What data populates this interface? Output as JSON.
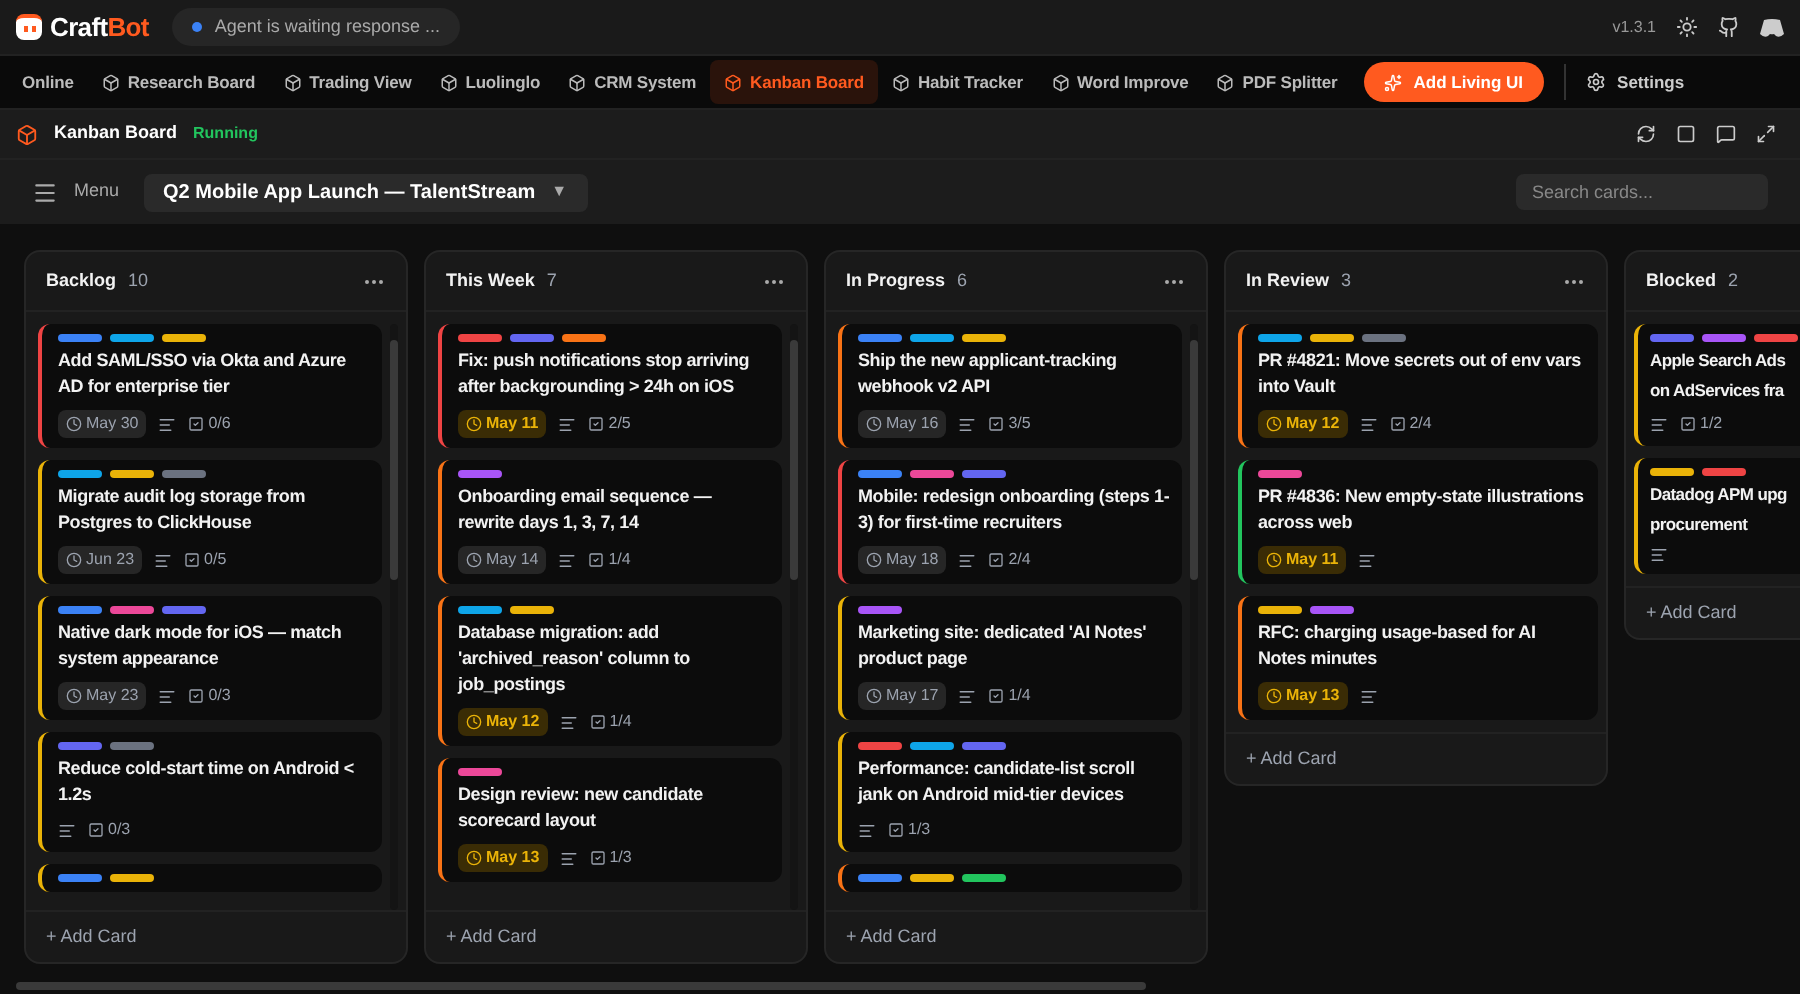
{
  "app": {
    "brand": [
      "Craft",
      "Bot"
    ],
    "status": {
      "text": "Agent is waiting response ...",
      "color": "#3b82f6"
    },
    "version": "v1.3.1"
  },
  "tabs": [
    {
      "label": "Online",
      "selected": false
    },
    {
      "label": "Research Board",
      "selected": false
    },
    {
      "label": "Trading View",
      "selected": false
    },
    {
      "label": "Luolinglo",
      "selected": false
    },
    {
      "label": "CRM System",
      "selected": false
    },
    {
      "label": "Kanban Board",
      "selected": true
    },
    {
      "label": "Habit Tracker",
      "selected": false
    },
    {
      "label": "Word Improve",
      "selected": false
    },
    {
      "label": "PDF Splitter",
      "selected": false
    }
  ],
  "add_button": "Add Living UI",
  "settings": "Settings",
  "panel": {
    "title": "Kanban Board",
    "status": "Running"
  },
  "toolbar": {
    "menu": "Menu",
    "board": "Q2 Mobile App Launch — TalentStream",
    "board_caret": "▼",
    "search": {
      "placeholder": "Search cards..."
    }
  },
  "columns": [
    {
      "name": "Backlog",
      "count": "10",
      "add_card": "+ Add Card",
      "cards": [
        {
          "color": "#ef4444",
          "labels": [
            {
              "color": "#3b82f6"
            },
            {
              "color": "#0ea5e9"
            },
            {
              "color": "#eab308"
            }
          ],
          "title": "Add SAML/SSO via Okta and Azure AD for enterprise tier",
          "due": {
            "text": "May 30",
            "soon": false
          },
          "notes": true,
          "checklist": "0/6"
        },
        {
          "color": "#eab308",
          "labels": [
            {
              "color": "#0ea5e9"
            },
            {
              "color": "#eab308"
            },
            {
              "color": "#6b7280"
            }
          ],
          "title": "Migrate audit log storage from Postgres to ClickHouse",
          "due": {
            "text": "Jun 23",
            "soon": false
          },
          "notes": true,
          "checklist": "0/5"
        },
        {
          "color": "#eab308",
          "labels": [
            {
              "color": "#3b82f6"
            },
            {
              "color": "#ec4899"
            },
            {
              "color": "#6366f1"
            }
          ],
          "title": "Native dark mode for iOS — match system appearance",
          "due": {
            "text": "May 23",
            "soon": false
          },
          "notes": true,
          "checklist": "0/3"
        },
        {
          "color": "#eab308",
          "labels": [
            {
              "color": "#6366f1"
            },
            {
              "color": "#6b7280"
            }
          ],
          "title": "Reduce cold-start time on Android < 1.2s",
          "notes": true,
          "checklist": "0/3"
        },
        {
          "color": "#eab308",
          "labels": [
            {
              "color": "#3b82f6"
            },
            {
              "color": "#eab308"
            }
          ]
        }
      ]
    },
    {
      "name": "This Week",
      "count": "7",
      "add_card": "+ Add Card",
      "cards": [
        {
          "color": "#ef4444",
          "labels": [
            {
              "color": "#ef4444"
            },
            {
              "color": "#6366f1"
            },
            {
              "color": "#f97316"
            }
          ],
          "title": "Fix: push notifications stop arriving after backgrounding > 24h on iOS",
          "due": {
            "text": "May 11",
            "soon": true
          },
          "notes": true,
          "checklist": "2/5"
        },
        {
          "color": "#f97316",
          "labels": [
            {
              "color": "#a855f7"
            }
          ],
          "title": "Onboarding email sequence — rewrite days 1, 3, 7, 14",
          "due": {
            "text": "May 14",
            "soon": false
          },
          "notes": true,
          "checklist": "1/4"
        },
        {
          "color": "#f97316",
          "labels": [
            {
              "color": "#0ea5e9"
            },
            {
              "color": "#eab308"
            }
          ],
          "title": "Database migration: add 'archived_reason' column to job_postings",
          "due": {
            "text": "May 12",
            "soon": true
          },
          "notes": true,
          "checklist": "1/4"
        },
        {
          "color": "#f97316",
          "labels": [
            {
              "color": "#ec4899"
            }
          ],
          "title": "Design review: new candidate scorecard layout",
          "due": {
            "text": "May 13",
            "soon": true
          },
          "notes": true,
          "checklist": "1/3"
        }
      ]
    },
    {
      "name": "In Progress",
      "count": "6",
      "add_card": "+ Add Card",
      "cards": [
        {
          "color": "#f97316",
          "labels": [
            {
              "color": "#3b82f6"
            },
            {
              "color": "#0ea5e9"
            },
            {
              "color": "#eab308"
            }
          ],
          "title": "Ship the new applicant-tracking webhook v2 API",
          "due": {
            "text": "May 16",
            "soon": false
          },
          "notes": true,
          "checklist": "3/5"
        },
        {
          "color": "#ef4444",
          "labels": [
            {
              "color": "#3b82f6"
            },
            {
              "color": "#ec4899"
            },
            {
              "color": "#6366f1"
            }
          ],
          "title": "Mobile: redesign onboarding (steps 1-3) for first-time recruiters",
          "due": {
            "text": "May 18",
            "soon": false
          },
          "notes": true,
          "checklist": "2/4"
        },
        {
          "color": "#eab308",
          "labels": [
            {
              "color": "#a855f7"
            }
          ],
          "title": "Marketing site: dedicated 'AI Notes' product page",
          "due": {
            "text": "May 17",
            "soon": false
          },
          "notes": true,
          "checklist": "1/4"
        },
        {
          "color": "#eab308",
          "labels": [
            {
              "color": "#ef4444"
            },
            {
              "color": "#0ea5e9"
            },
            {
              "color": "#6366f1"
            }
          ],
          "title": "Performance: candidate-list scroll jank on Android mid-tier devices",
          "notes": true,
          "checklist": "1/3"
        },
        {
          "color": "#f97316",
          "labels": [
            {
              "color": "#3b82f6"
            },
            {
              "color": "#eab308"
            },
            {
              "color": "#22c55e"
            }
          ]
        }
      ]
    },
    {
      "name": "In Review",
      "count": "3",
      "add_card": "+ Add Card",
      "cards": [
        {
          "color": "#f97316",
          "labels": [
            {
              "color": "#0ea5e9"
            },
            {
              "color": "#eab308"
            },
            {
              "color": "#6b7280"
            }
          ],
          "title": "PR #4821: Move secrets out of env vars into Vault",
          "due": {
            "text": "May 12",
            "soon": true
          },
          "notes": true,
          "checklist": "2/4"
        },
        {
          "color": "#22c55e",
          "labels": [
            {
              "color": "#ec4899"
            }
          ],
          "title": "PR #4836: New empty-state illustrations across web",
          "due": {
            "text": "May 11",
            "soon": true
          },
          "notes": true
        },
        {
          "color": "#f97316",
          "labels": [
            {
              "color": "#eab308"
            },
            {
              "color": "#a855f7"
            }
          ],
          "title": "RFC: charging usage-based for AI Notes minutes",
          "due": {
            "text": "May 13",
            "soon": true
          },
          "notes": true
        }
      ]
    },
    {
      "name": "Blocked",
      "count": "2",
      "add_card": "+ Add Card",
      "cards": [
        {
          "color": "#eab308",
          "labels": [
            {
              "color": "#6366f1"
            },
            {
              "color": "#a855f7"
            },
            {
              "color": "#ef4444"
            }
          ],
          "title_lines": [
            "Apple Search Ads",
            "on AdServices fra"
          ],
          "notes": true,
          "checklist": "1/2"
        },
        {
          "color": "#eab308",
          "labels": [
            {
              "color": "#eab308"
            },
            {
              "color": "#ef4444"
            }
          ],
          "title_lines": [
            "Datadog APM upg",
            "procurement"
          ],
          "notes": true
        }
      ]
    }
  ]
}
